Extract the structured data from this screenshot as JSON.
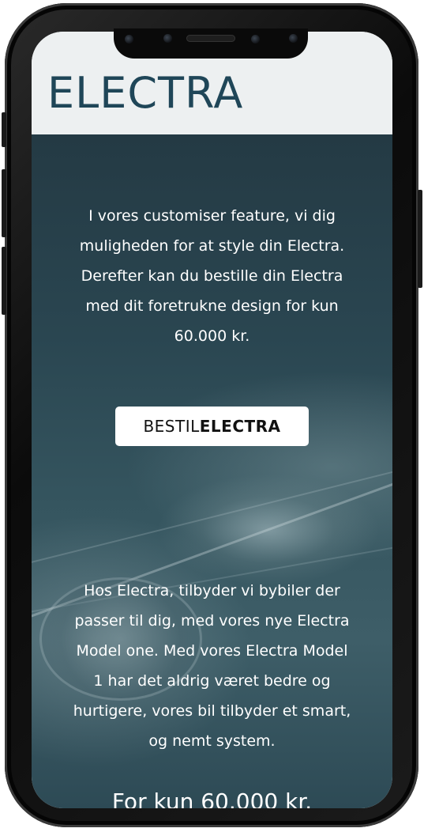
{
  "header": {
    "logo": "ELECTRA"
  },
  "hero": {
    "intro": "I vores customiser feature, vi dig muligheden for at style din Electra. Derefter kan du bestille din Electra med dit foretrukne design for kun 60.000 kr.",
    "order_button": {
      "label_regular": "BESTIL",
      "label_bold": "ELECTRA"
    },
    "about": "Hos Electra, tilbyder vi bybiler der passer til dig, med vores nye Electra Model one. Med vores Electra Model 1 har det aldrig været bedre og hurtigere, vores bil tilbyder et smart, og nemt system.",
    "price": "For kun 60.000 kr."
  },
  "colors": {
    "brand": "#1f4658",
    "hero_bg": "#2a4651",
    "button_bg": "#ffffff"
  }
}
